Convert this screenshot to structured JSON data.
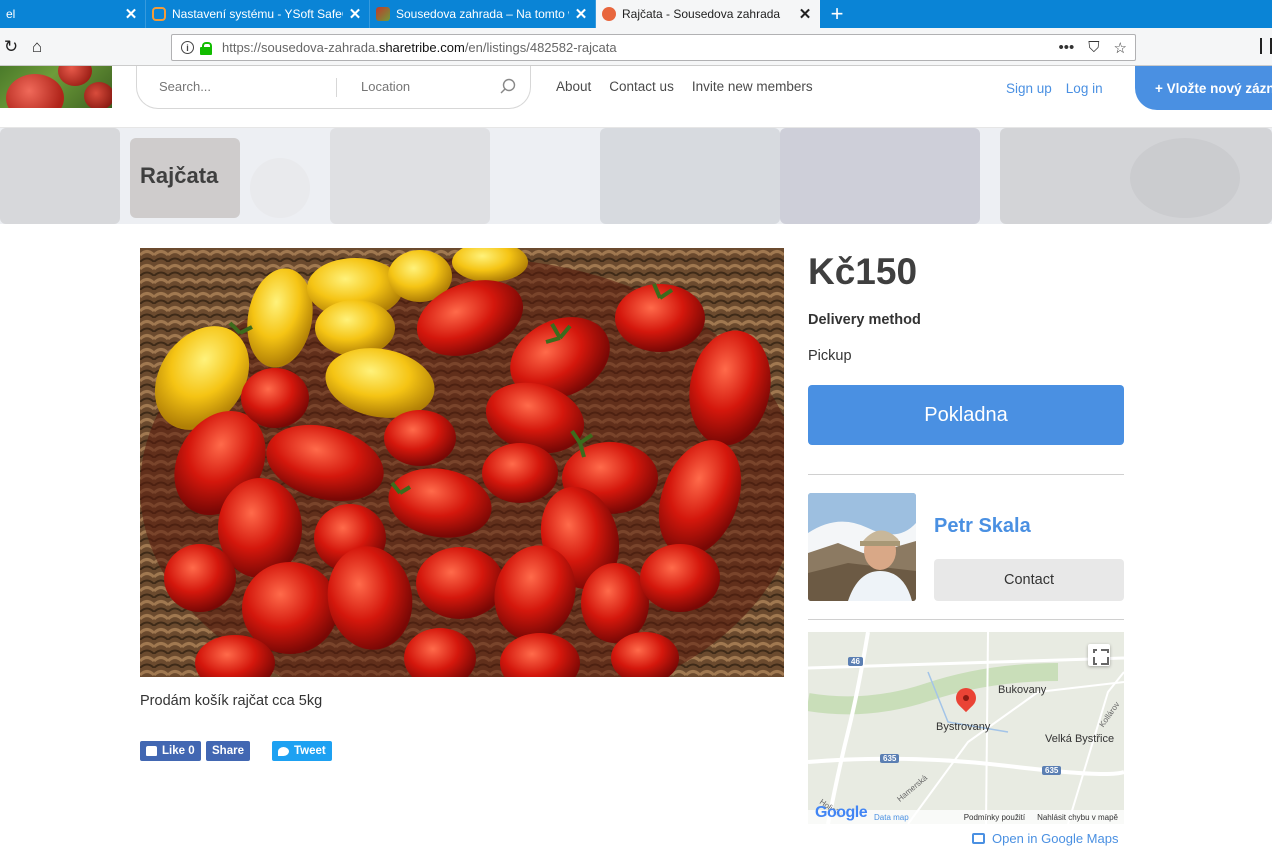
{
  "browser": {
    "tabs": [
      {
        "title": "el",
        "active": false
      },
      {
        "title": "Nastavení systému - YSoft SafeQ",
        "active": false
      },
      {
        "title": "Sousedova zahrada – Na tomto we",
        "active": false
      },
      {
        "title": "Rajčata - Sousedova zahrada",
        "active": true
      }
    ],
    "url_prefix": "https://sousedova-zahrada.",
    "url_domain": "sharetribe.com",
    "url_path": "/en/listings/482582-rajcata"
  },
  "header": {
    "search_placeholder": "Search...",
    "location_placeholder": "Location",
    "nav": [
      "About",
      "Contact us",
      "Invite new members"
    ],
    "sign_up": "Sign up",
    "log_in": "Log in",
    "post_button": "+ Vložte nový zázn"
  },
  "listing": {
    "title": "Rajčata",
    "description": "Prodám košík rajčat cca 5kg",
    "price": "Kč150",
    "delivery_label": "Delivery method",
    "delivery_value": "Pickup",
    "checkout_label": "Pokladna",
    "author_name": "Petr Skala",
    "contact_label": "Contact"
  },
  "social": {
    "like_label": "Like",
    "like_count": "0",
    "share_label": "Share",
    "tweet_label": "Tweet"
  },
  "map": {
    "places": [
      "Bukovany",
      "Bystrovany",
      "Velká Bystřice",
      "Kollárov"
    ],
    "roads": [
      "46",
      "635",
      "635"
    ],
    "streets": [
      "Holická",
      "Hamerská"
    ],
    "logo": "Google",
    "map_data": "Data map",
    "terms": "Podmínky použití",
    "report": "Nahlásit chybu v mapě",
    "open_link": "Open in Google Maps"
  }
}
